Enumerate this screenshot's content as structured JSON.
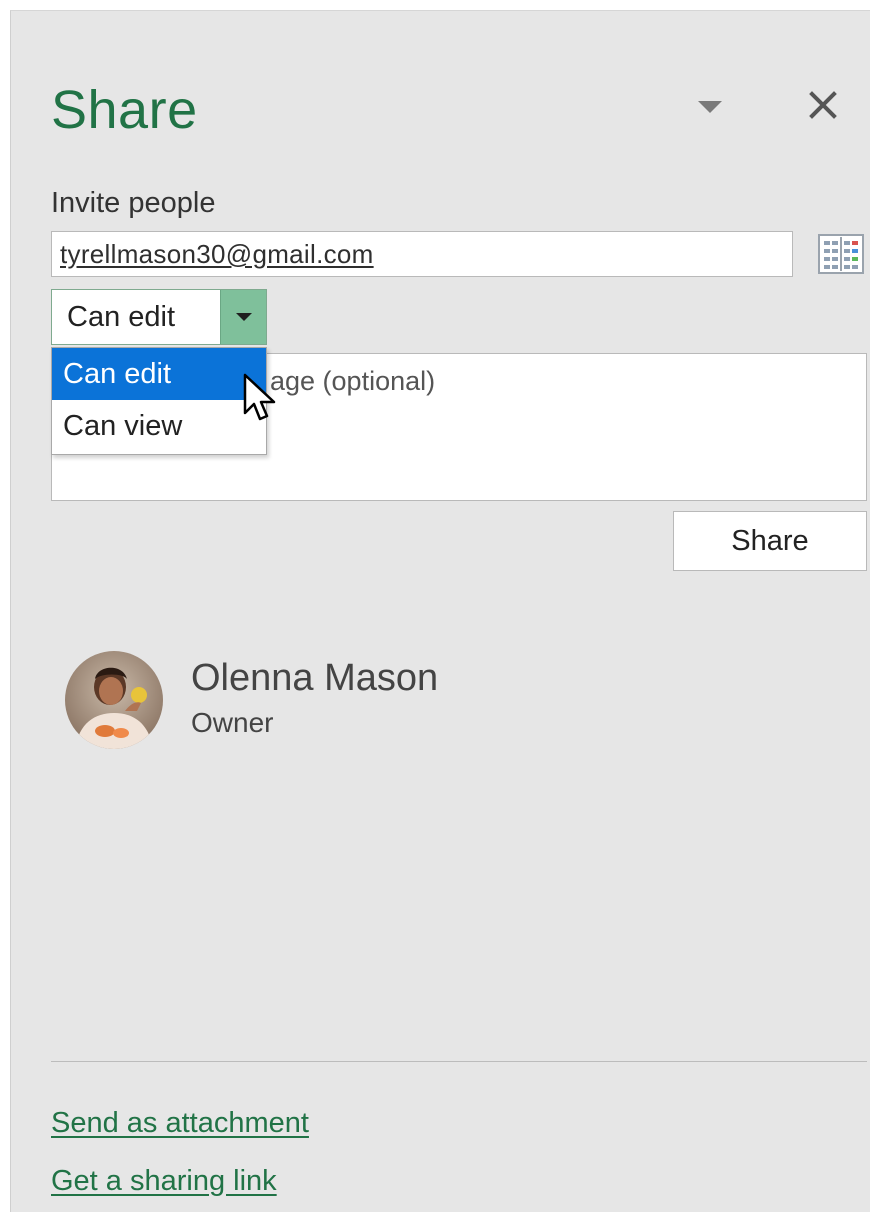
{
  "pane": {
    "title": "Share",
    "menu_icon": "chevron-down-icon",
    "close_icon": "close-icon"
  },
  "invite": {
    "label": "Invite people",
    "email_value": "tyrellmason30@gmail.com",
    "address_book_icon": "address-book-icon"
  },
  "permission": {
    "selected": "Can edit",
    "options": [
      "Can edit",
      "Can view"
    ],
    "highlighted_option": "Can edit"
  },
  "message": {
    "placeholder": "Include a personal message (optional)",
    "visible_fragment": "age (optional)"
  },
  "share_button": {
    "label": "Share"
  },
  "people": [
    {
      "name": "Olenna Mason",
      "role": "Owner"
    }
  ],
  "links": {
    "send_attachment": "Send as attachment",
    "sharing_link": "Get a sharing link"
  },
  "colors": {
    "accent": "#217346",
    "selection": "#0b73d8",
    "dropdown_button": "#7fc09b",
    "pane_background": "#e6e6e6"
  }
}
